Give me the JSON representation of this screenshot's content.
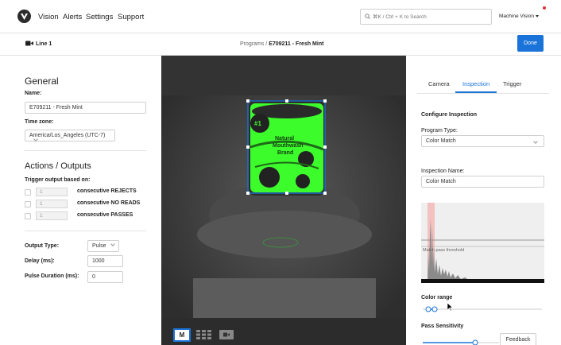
{
  "nav": {
    "items": [
      "Vision",
      "Alerts",
      "Settings",
      "Support"
    ],
    "search_placeholder": "⌘K / Ctrl + K to Search",
    "machine_label": "Machine Vision"
  },
  "subheader": {
    "line_label": "Line 1",
    "breadcrumb_parent": "Programs",
    "breadcrumb_sep": " / ",
    "breadcrumb_current": "E709211 - Fresh Mint",
    "done_label": "Done"
  },
  "general": {
    "heading": "General",
    "name_label": "Name:",
    "name_value": "E709211 - Fresh Mint",
    "timezone_label": "Time zone:",
    "timezone_value": "America/Los_Angeles (UTC-7)"
  },
  "actions": {
    "heading": "Actions / Outputs",
    "trigger_label": "Trigger output based on:",
    "rows": [
      {
        "count": "1",
        "label": "consecutive REJECTS"
      },
      {
        "count": "1",
        "label": "consecutive NO READS"
      },
      {
        "count": "1",
        "label": "consecutive PASSES"
      }
    ]
  },
  "output": {
    "type_label": "Output Type:",
    "type_value": "Pulse",
    "delay_label": "Delay (ms):",
    "delay_value": "1000",
    "pulse_label": "Pulse Duration (ms):",
    "pulse_value": "0"
  },
  "camera": {
    "view_mode_label": "M",
    "product_text": [
      "#1",
      "Natural",
      "Mouthwash",
      "Brand"
    ]
  },
  "inspection": {
    "tabs": [
      "Camera",
      "Inspection",
      "Trigger"
    ],
    "active_tab": "Inspection",
    "heading": "Configure Inspection",
    "program_type_label": "Program Type:",
    "program_type_value": "Color Match",
    "inspection_name_label": "Inspection Name:",
    "inspection_name_value": "Color Match",
    "histogram_label": "Match pass threshold",
    "color_range_label": "Color range",
    "pass_sensitivity_label": "Pass Sensitivity",
    "feedback_label": "Feedback"
  },
  "colors": {
    "accent": "#1a73d9",
    "match_green": "#3dfc2c",
    "notification": "#e0303a"
  }
}
